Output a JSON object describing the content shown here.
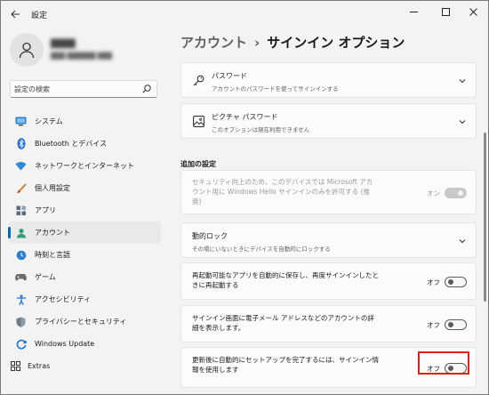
{
  "window": {
    "title": "設定",
    "back_icon": "back-arrow-icon",
    "controls": [
      "minimize-icon",
      "maximize-icon",
      "close-icon"
    ]
  },
  "profile": {
    "name": "████",
    "email": "███ ██████ ███"
  },
  "search": {
    "placeholder": "設定の検索"
  },
  "nav": {
    "items": [
      {
        "label": "システム",
        "icon": "monitor-icon",
        "active": false
      },
      {
        "label": "Bluetooth とデバイス",
        "icon": "bluetooth-icon",
        "active": false
      },
      {
        "label": "ネットワークとインターネット",
        "icon": "wifi-icon",
        "active": false
      },
      {
        "label": "個人用設定",
        "icon": "brush-icon",
        "active": false
      },
      {
        "label": "アプリ",
        "icon": "apps-icon",
        "active": false
      },
      {
        "label": "アカウント",
        "icon": "person-icon",
        "active": true
      },
      {
        "label": "時刻と言語",
        "icon": "globe-clock-icon",
        "active": false
      },
      {
        "label": "ゲーム",
        "icon": "gamepad-icon",
        "active": false
      },
      {
        "label": "アクセシビリティ",
        "icon": "accessibility-icon",
        "active": false
      },
      {
        "label": "プライバシーとセキュリティ",
        "icon": "shield-icon",
        "active": false
      },
      {
        "label": "Windows Update",
        "icon": "windows-update-icon",
        "active": false
      },
      {
        "label": "Extras",
        "icon": "extras-icon",
        "active": false
      }
    ]
  },
  "breadcrumb": {
    "parent": "アカウント",
    "separator": "›",
    "current": "サインイン オプション"
  },
  "signin_methods": [
    {
      "title": "パスワード",
      "desc": "アカウントのパスワードを使ってサインインする",
      "icon": "key-icon"
    },
    {
      "title": "ピクチャ パスワード",
      "desc": "このオプションは現在利用できません",
      "icon": "picture-icon"
    }
  ],
  "additional": {
    "title": "追加の設定",
    "windows_hello_only": {
      "text": "セキュリティ向上のため、このデバイスでは Microsoft アカウント用に Windows Hello サインインのみを許可する (推奨)",
      "state_label": "オン",
      "enabled": false
    },
    "dynamic_lock": {
      "title": "動的ロック",
      "desc": "その場にいないときにデバイスを自動的にロックする"
    },
    "restart_apps": {
      "text": "再起動可能なアプリを自動的に保存し、再度サインインしたときに再起動する",
      "state_label": "オフ"
    },
    "show_account_details": {
      "text": "サインイン画面に電子メール アドレスなどのアカウントの詳細を表示します。",
      "state_label": "オフ"
    },
    "finish_setup": {
      "text": "更新後に自動的にセットアップを完了するには、サインイン情報を使用します",
      "state_label": "オフ"
    }
  },
  "colors": {
    "accent": "#0067c0",
    "highlight": "#e0201c"
  }
}
